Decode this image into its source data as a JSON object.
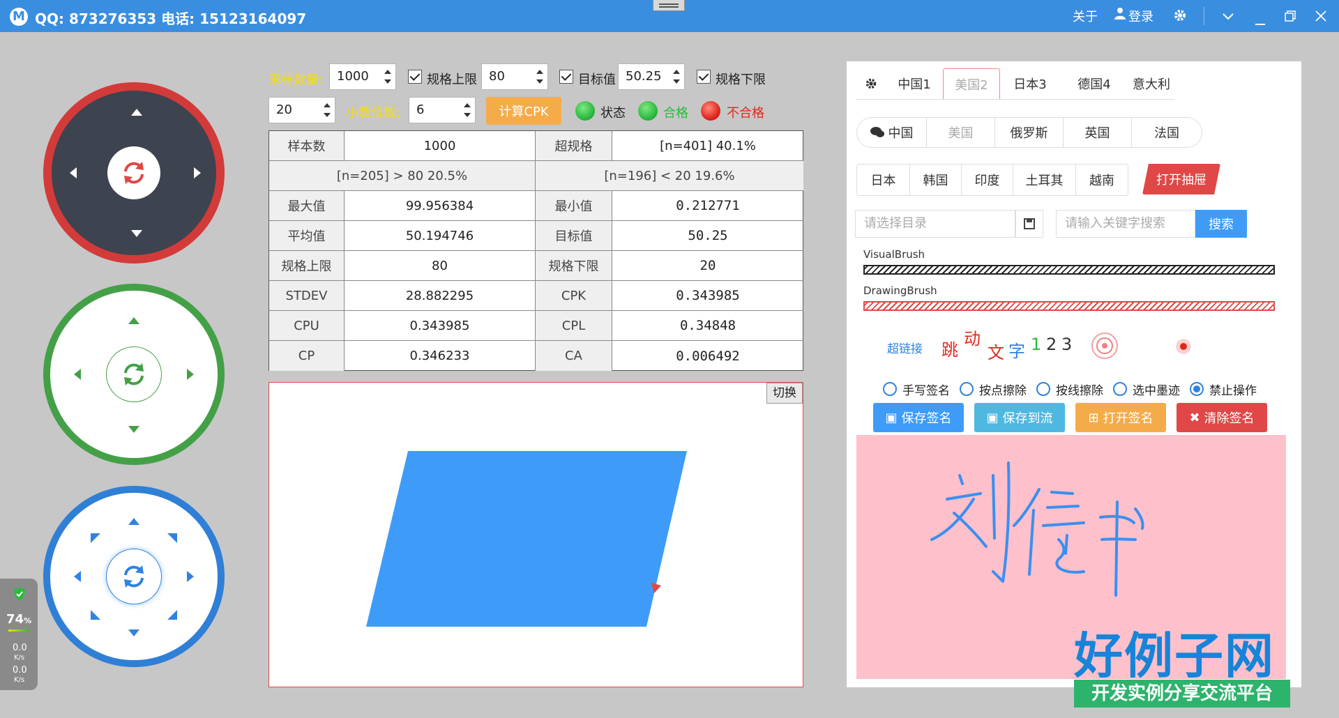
{
  "titlebar": {
    "logo_letter": "M",
    "title": "QQ: 873276353 电话: 15123164097",
    "about": "关于",
    "login": "登录",
    "login_icon": "user-icon",
    "icons": [
      "gear-icon",
      "chevron-down-icon",
      "minimize-icon",
      "maximize-icon",
      "close-icon"
    ]
  },
  "controls": {
    "sample_label": "采样数量:",
    "sample_value": "1000",
    "usl_label": "规格上限",
    "usl_value": "80",
    "target_label": "目标值",
    "target_value": "50.25",
    "lsl_label": "规格下限",
    "lsl_value": "20",
    "decimal_label": "小数位数:",
    "decimal_value": "6",
    "calc_button": "计算CPK",
    "status_label": "状态",
    "pass_label": "合格",
    "fail_label": "不合格"
  },
  "colors": {
    "accent": "#3a8ee0",
    "status_led": "#2dba3f",
    "pass_led": "#2dba3f",
    "fail_led": "#e0281e",
    "label_yellow": "#f5e000"
  },
  "table": {
    "row0": [
      "样本数",
      "1000",
      "超规格",
      "[n=401]   40.1%"
    ],
    "row1": [
      "[n=205] > 80   20.5%",
      "[n=196] < 20   19.6%"
    ],
    "rows": [
      [
        "最大值",
        "99.956384",
        "最小值",
        "0.212771"
      ],
      [
        "平均值",
        "50.194746",
        "目标值",
        "50.25"
      ],
      [
        "规格上限",
        "80",
        "规格下限",
        "20"
      ],
      [
        "STDEV",
        "28.882295",
        "CPK",
        "0.343985"
      ],
      [
        "CPU",
        "0.343985",
        "CPL",
        "0.34848"
      ],
      [
        "CP",
        "0.346233",
        "CA",
        "0.006492"
      ]
    ]
  },
  "canvas": {
    "switch_button": "切换"
  },
  "right_panel": {
    "tabs1": [
      "中国1",
      "美国2",
      "日本3",
      "德国4",
      "意大利"
    ],
    "tabs2": [
      "中国",
      "美国",
      "俄罗斯",
      "英国",
      "法国"
    ],
    "tabs3": [
      "日本",
      "韩国",
      "印度",
      "土耳其",
      "越南"
    ],
    "drawer_button": "打开抽屉",
    "dir_placeholder": "请选择目录",
    "search_placeholder": "请输入关键字搜索",
    "search_button": "搜索",
    "visual_brush": "VisualBrush",
    "drawing_brush": "DrawingBrush",
    "hyperlink": "超链接",
    "jump_text": [
      "跳",
      "动",
      "文",
      "字",
      "1",
      "2",
      "3"
    ],
    "radios": [
      "手写签名",
      "按点擦除",
      "按线擦除",
      "选中墨迹",
      "禁止操作"
    ],
    "selected_radio": 4,
    "buttons": [
      "保存签名",
      "保存到流",
      "打开签名",
      "清除签名"
    ]
  },
  "widget": {
    "percent": "74",
    "percent_unit": "%",
    "up_speed": "0.0",
    "up_unit": "K/s",
    "down_speed": "0.0",
    "down_unit": "K/s"
  },
  "watermark": {
    "big": "好例子网",
    "small": "开发实例分享交流平台"
  }
}
